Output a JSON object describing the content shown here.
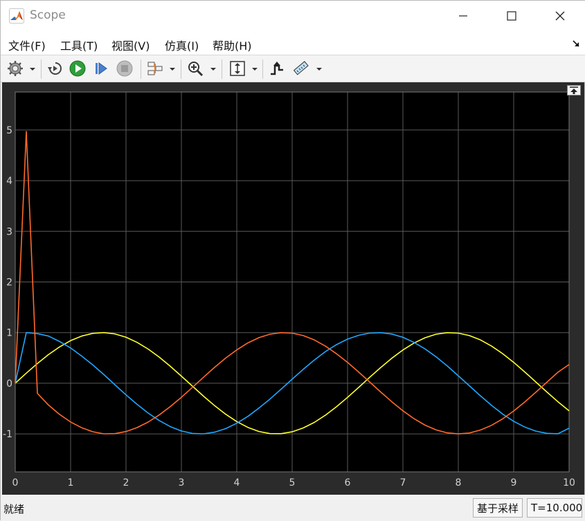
{
  "window": {
    "title": "Scope",
    "controls": {
      "minimize": "minimize-icon",
      "maximize": "maximize-icon",
      "close": "close-icon"
    }
  },
  "menu": {
    "items": [
      {
        "label": "文件(F)"
      },
      {
        "label": "工具(T)"
      },
      {
        "label": "视图(V)"
      },
      {
        "label": "仿真(I)"
      },
      {
        "label": "帮助(H)"
      }
    ]
  },
  "toolbar": {
    "icons": [
      "gear-icon",
      "restore-icon",
      "run-icon",
      "step-forward-icon",
      "stop-icon",
      "highlight-signal-icon",
      "zoom-icon",
      "scale-axes-icon",
      "triggers-icon",
      "measurements-icon"
    ]
  },
  "status": {
    "left": "就绪",
    "mode": "基于采样",
    "time": "T=10.000"
  },
  "colors": {
    "plot_bg": "#000000",
    "frame_bg": "#2b2b2b",
    "grid": "#5a5a5a",
    "tick_text": "#d0d0d0",
    "series_yellow": "#ffff2d",
    "series_blue": "#1fa7ff",
    "series_orange": "#ff6a2b"
  },
  "chart_data": {
    "type": "line",
    "title": "",
    "xlabel": "",
    "ylabel": "",
    "xlim": [
      0,
      10
    ],
    "ylim": [
      -1.75,
      5.75
    ],
    "xticks": [
      0,
      1,
      2,
      3,
      4,
      5,
      6,
      7,
      8,
      9,
      10
    ],
    "yticks": [
      -1,
      0,
      1,
      2,
      3,
      4,
      5
    ],
    "grid": true,
    "series": [
      {
        "color": "yellow",
        "x": [
          0,
          0.2,
          0.4,
          0.6,
          0.8,
          1.0,
          1.2,
          1.4,
          1.6,
          1.8,
          2.0,
          2.2,
          2.4,
          2.6,
          2.8,
          3.0,
          3.2,
          3.4,
          3.6,
          3.8,
          4.0,
          4.2,
          4.4,
          4.6,
          4.8,
          5.0,
          5.2,
          5.4,
          5.6,
          5.8,
          6.0,
          6.2,
          6.4,
          6.6,
          6.8,
          7.0,
          7.2,
          7.4,
          7.6,
          7.8,
          8.0,
          8.2,
          8.4,
          8.6,
          8.8,
          9.0,
          9.2,
          9.4,
          9.6,
          9.8,
          10.0
        ],
        "y": [
          0,
          0.199,
          0.389,
          0.565,
          0.717,
          0.841,
          0.932,
          0.985,
          1.0,
          0.974,
          0.909,
          0.808,
          0.675,
          0.516,
          0.335,
          0.141,
          -0.058,
          -0.256,
          -0.443,
          -0.612,
          -0.757,
          -0.872,
          -0.952,
          -0.994,
          -0.996,
          -0.959,
          -0.883,
          -0.773,
          -0.631,
          -0.465,
          -0.279,
          -0.083,
          0.117,
          0.312,
          0.494,
          0.657,
          0.794,
          0.899,
          0.968,
          0.999,
          0.989,
          0.941,
          0.855,
          0.734,
          0.585,
          0.412,
          0.223,
          0.025,
          -0.174,
          -0.366,
          -0.544
        ]
      },
      {
        "color": "blue",
        "x": [
          0,
          0.2,
          0.4,
          0.6,
          0.8,
          1.0,
          1.2,
          1.4,
          1.6,
          1.8,
          2.0,
          2.2,
          2.4,
          2.6,
          2.8,
          3.0,
          3.2,
          3.4,
          3.6,
          3.8,
          4.0,
          4.2,
          4.4,
          4.6,
          4.8,
          5.0,
          5.2,
          5.4,
          5.6,
          5.8,
          6.0,
          6.2,
          6.4,
          6.6,
          6.8,
          7.0,
          7.2,
          7.4,
          7.6,
          7.8,
          8.0,
          8.2,
          8.4,
          8.6,
          8.8,
          9.0,
          9.2,
          9.4,
          9.6,
          9.8,
          10.0
        ],
        "y": [
          0,
          1.0,
          0.98,
          0.932,
          0.825,
          0.697,
          0.537,
          0.362,
          0.171,
          -0.03,
          -0.229,
          -0.416,
          -0.589,
          -0.737,
          -0.857,
          -0.942,
          -0.99,
          -0.998,
          -0.966,
          -0.896,
          -0.79,
          -0.654,
          -0.49,
          -0.312,
          -0.118,
          0.08,
          0.275,
          0.458,
          0.624,
          0.762,
          0.871,
          0.947,
          0.99,
          0.999,
          0.971,
          0.907,
          0.808,
          0.677,
          0.52,
          0.342,
          0.147,
          -0.051,
          -0.249,
          -0.437,
          -0.608,
          -0.751,
          -0.865,
          -0.946,
          -0.989,
          -0.997,
          -0.888
        ]
      },
      {
        "color": "orange",
        "x": [
          0,
          0.2,
          0.4,
          0.6,
          0.8,
          1.0,
          1.2,
          1.4,
          1.6,
          1.8,
          2.0,
          2.2,
          2.4,
          2.6,
          2.8,
          3.0,
          3.2,
          3.4,
          3.6,
          3.8,
          4.0,
          4.2,
          4.4,
          4.6,
          4.8,
          5.0,
          5.2,
          5.4,
          5.6,
          5.8,
          6.0,
          6.2,
          6.4,
          6.6,
          6.8,
          7.0,
          7.2,
          7.4,
          7.6,
          7.8,
          8.0,
          8.2,
          8.4,
          8.6,
          8.8,
          9.0,
          9.2,
          9.4,
          9.6,
          9.8,
          10.0
        ],
        "y": [
          0,
          4.97,
          -0.2,
          -0.431,
          -0.615,
          -0.765,
          -0.879,
          -0.958,
          -0.998,
          -0.995,
          -0.954,
          -0.876,
          -0.766,
          -0.626,
          -0.461,
          -0.277,
          -0.081,
          0.119,
          0.314,
          0.497,
          0.659,
          0.796,
          0.9,
          0.969,
          0.999,
          0.989,
          0.941,
          0.855,
          0.733,
          0.584,
          0.412,
          0.223,
          0.025,
          -0.174,
          -0.366,
          -0.544,
          -0.7,
          -0.828,
          -0.922,
          -0.98,
          -1.0,
          -0.982,
          -0.924,
          -0.83,
          -0.703,
          -0.548,
          -0.37,
          -0.178,
          0.021,
          0.219,
          0.37
        ]
      }
    ]
  }
}
